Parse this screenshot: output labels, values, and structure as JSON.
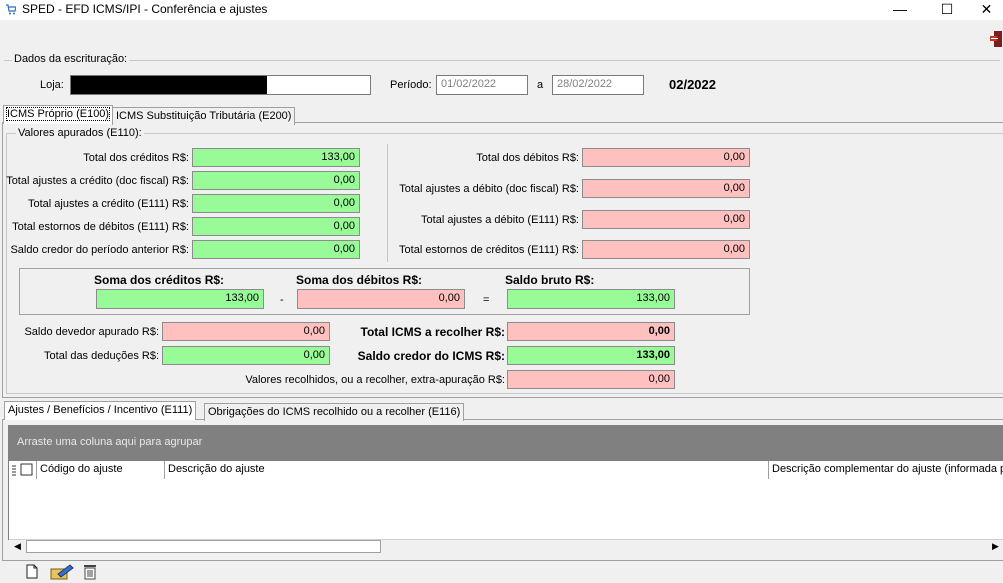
{
  "window": {
    "title": "SPED - EFD ICMS/IPI - Conferência e ajustes",
    "minimize": "—",
    "maximize": "☐",
    "close": "✕"
  },
  "dados": {
    "legend": "Dados da escrituração:",
    "loja_label": "Loja:",
    "periodo_label": "Período:",
    "periodo_inicio": "01/02/2022",
    "a_label": "a",
    "periodo_fim": "28/02/2022",
    "competencia": "02/2022"
  },
  "tabs_top": [
    "ICMS Próprio (E100)",
    "ICMS Substituição Tributária (E200)"
  ],
  "valores": {
    "legend": "Valores apurados (E110):",
    "left": [
      {
        "label": "Total dos créditos R$:",
        "value": "133,00"
      },
      {
        "label": "Total ajustes a crédito (doc fiscal) R$:",
        "value": "0,00"
      },
      {
        "label": "Total ajustes a crédito (E111) R$:",
        "value": "0,00"
      },
      {
        "label": "Total estornos de débitos (E111) R$:",
        "value": "0,00"
      },
      {
        "label": "Saldo credor do período anterior R$:",
        "value": "0,00"
      }
    ],
    "right": [
      {
        "label": "Total dos débitos R$:",
        "value": "0,00"
      },
      {
        "label": "Total ajustes a débito (doc fiscal) R$:",
        "value": "0,00"
      },
      {
        "label": "Total ajustes a débito (E111) R$:",
        "value": "0,00"
      },
      {
        "label": "Total estornos de créditos (E111) R$:",
        "value": "0,00"
      }
    ],
    "soma_creditos_label": "Soma dos créditos R$:",
    "soma_creditos": "133,00",
    "minus": "-",
    "soma_debitos_label": "Soma dos débitos R$:",
    "soma_debitos": "0,00",
    "equals": "=",
    "saldo_bruto_label": "Saldo bruto R$:",
    "saldo_bruto": "133,00",
    "saldo_devedor_label": "Saldo devedor apurado R$:",
    "saldo_devedor": "0,00",
    "total_deducoes_label": "Total das deduções R$:",
    "total_deducoes": "0,00",
    "total_icms_label": "Total ICMS a recolher R$:",
    "total_icms": "0,00",
    "saldo_credor_label": "Saldo credor do ICMS R$:",
    "saldo_credor": "133,00",
    "valores_recolhidos_label": "Valores recolhidos, ou a recolher, extra-apuração R$:",
    "valores_recolhidos": "0,00"
  },
  "tabs_bottom": [
    "Ajustes / Benefícios / Incentivo (E111)",
    "Obrigações do ICMS recolhido ou a recolher (E116)"
  ],
  "grid": {
    "group_hint": "Arraste uma coluna aqui para agrupar",
    "columns": [
      "Código do ajuste",
      "Descrição do ajuste",
      "Descrição complementar do ajuste (informada pe"
    ]
  },
  "colors": {
    "green": "#98fb98",
    "pink": "#ffc0c0",
    "group_bar": "#808080"
  }
}
